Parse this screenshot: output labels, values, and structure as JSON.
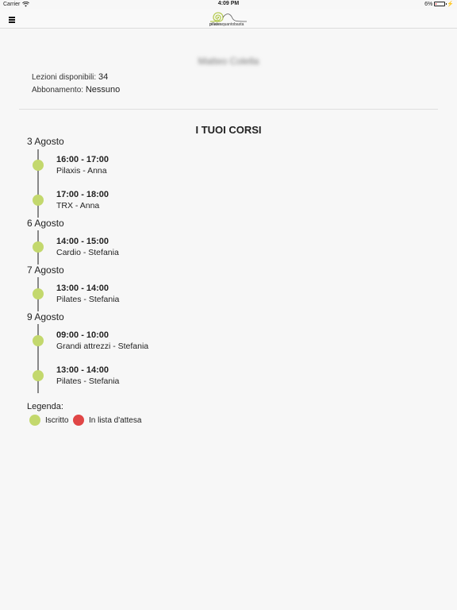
{
  "status_bar": {
    "carrier": "Carrier",
    "time": "4:09 PM",
    "battery": "6%"
  },
  "header": {
    "logo_text_bold": "pilates",
    "logo_text_regular": "quantobasta",
    "menu_icon": "hamburger-menu-icon"
  },
  "profile": {
    "name": "Matteo Colella",
    "lessons_label": "Lezioni disponibili:",
    "lessons_value": "34",
    "subscription_label": "Abbonamento:",
    "subscription_value": "Nessuno"
  },
  "courses": {
    "title": "I TUOI CORSI",
    "days": [
      {
        "date": "3 Agosto",
        "items": [
          {
            "time": "16:00 - 17:00",
            "name": "Pilaxis - Anna",
            "status": "iscritto"
          },
          {
            "time": "17:00 - 18:00",
            "name": "TRX - Anna",
            "status": "iscritto"
          }
        ]
      },
      {
        "date": "6 Agosto",
        "items": [
          {
            "time": "14:00 - 15:00",
            "name": "Cardio - Stefania",
            "status": "iscritto"
          }
        ]
      },
      {
        "date": "7 Agosto",
        "items": [
          {
            "time": "13:00 - 14:00",
            "name": "Pilates - Stefania",
            "status": "iscritto"
          }
        ]
      },
      {
        "date": "9 Agosto",
        "items": [
          {
            "time": "09:00 - 10:00",
            "name": "Grandi attrezzi - Stefania",
            "status": "iscritto"
          },
          {
            "time": "13:00 - 14:00",
            "name": "Pilates - Stefania",
            "status": "iscritto"
          }
        ]
      }
    ]
  },
  "legend": {
    "title": "Legenda:",
    "enrolled_label": "Iscritto",
    "waiting_label": "In lista d'attesa"
  },
  "colors": {
    "enrolled": "#c3d86d",
    "waiting": "#e04646",
    "timeline": "#888888"
  }
}
